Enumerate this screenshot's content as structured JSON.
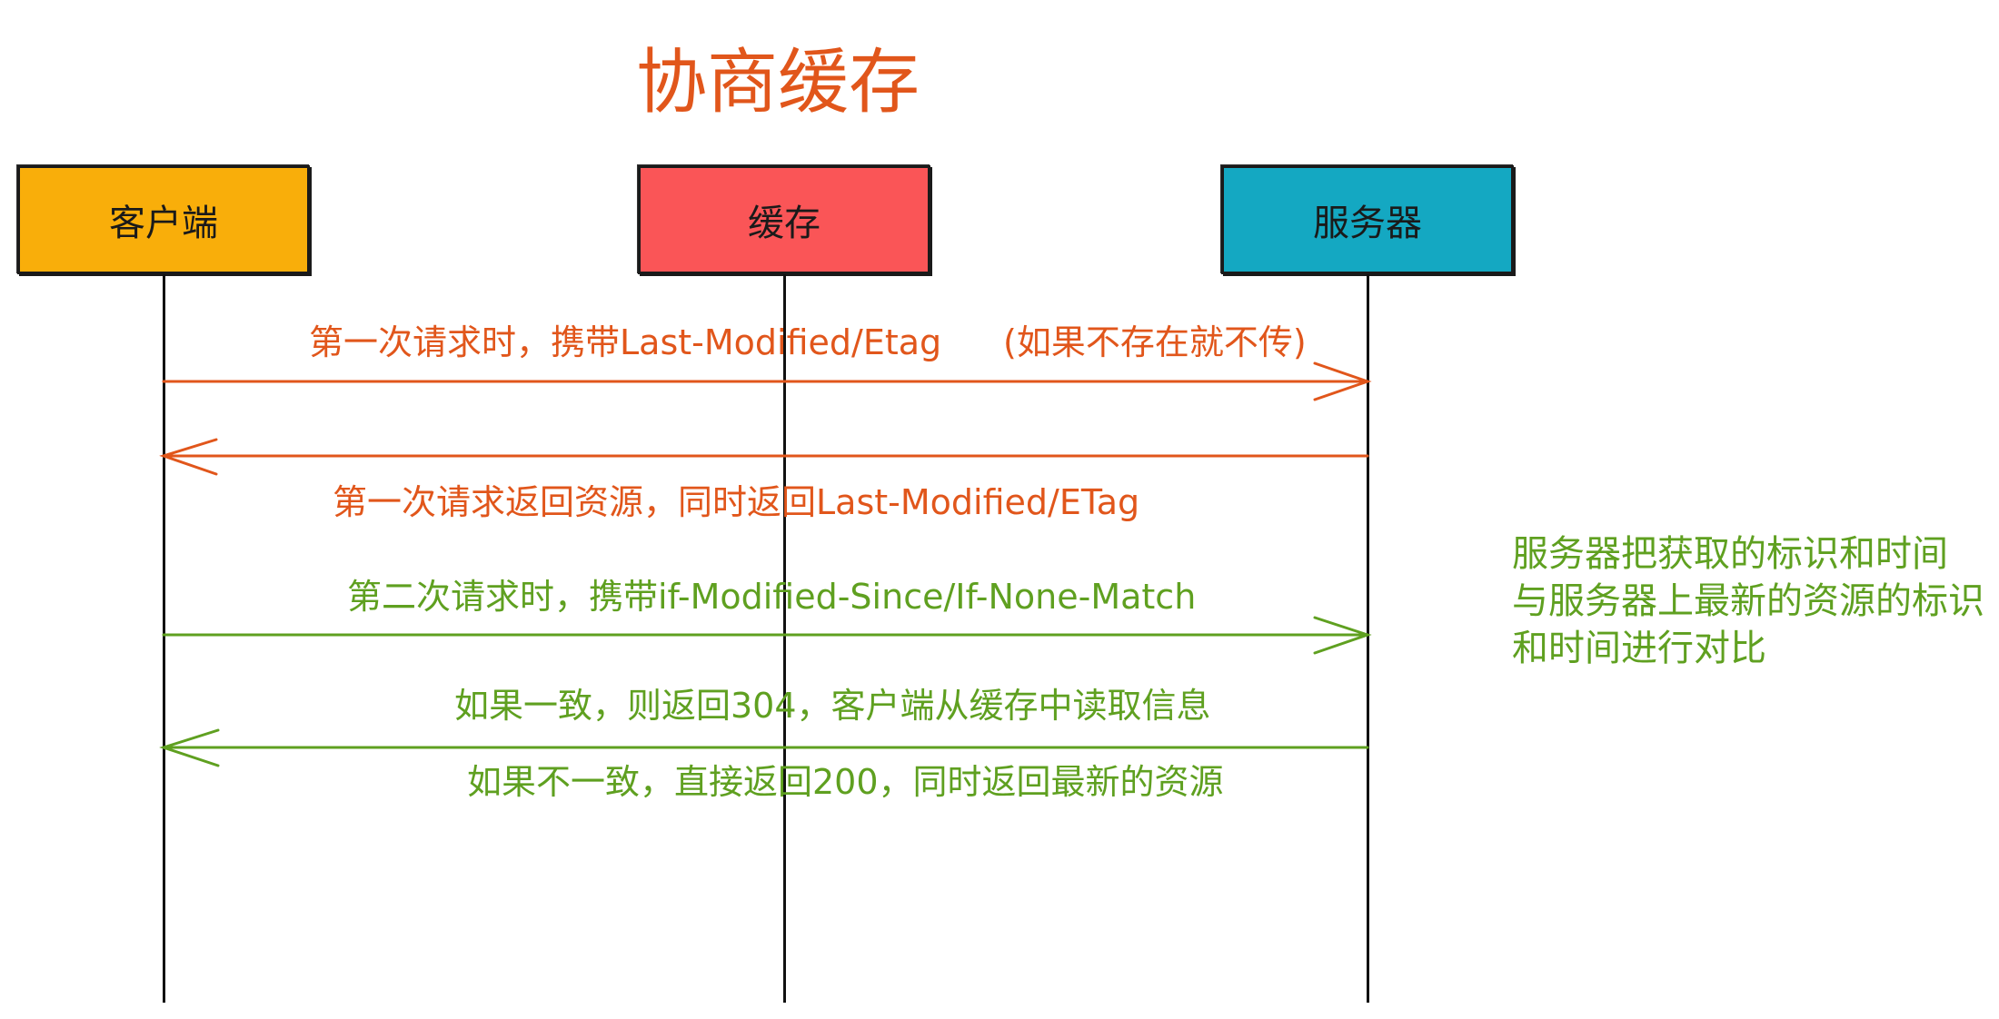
{
  "title": "协商缓存",
  "colors": {
    "title": "#e1561b",
    "first_request": "#e1561b",
    "second_request": "#5fa020",
    "client_box": "#f9ae0a",
    "cache_box": "#fa5557",
    "server_box": "#14a8c2"
  },
  "participants": {
    "client": "客户端",
    "cache": "缓存",
    "server": "服务器"
  },
  "messages": {
    "m1_label": "第一次请求时，携带Last-Modified/Etag",
    "m1_note": "(如果不存在就不传)",
    "m2_label": "第一次请求返回资源，同时返回Last-Modified/ETag",
    "m3_label": "第二次请求时，携带if-Modified-Since/If-None-Match",
    "m4_label_a": "如果一致，则返回304，客户端从缓存中读取信息",
    "m4_label_b": "如果不一致，直接返回200，同时返回最新的资源"
  },
  "server_note": {
    "line1": "服务器把获取的标识和时间",
    "line2": "与服务器上最新的资源的标识",
    "line3": "和时间进行对比"
  }
}
